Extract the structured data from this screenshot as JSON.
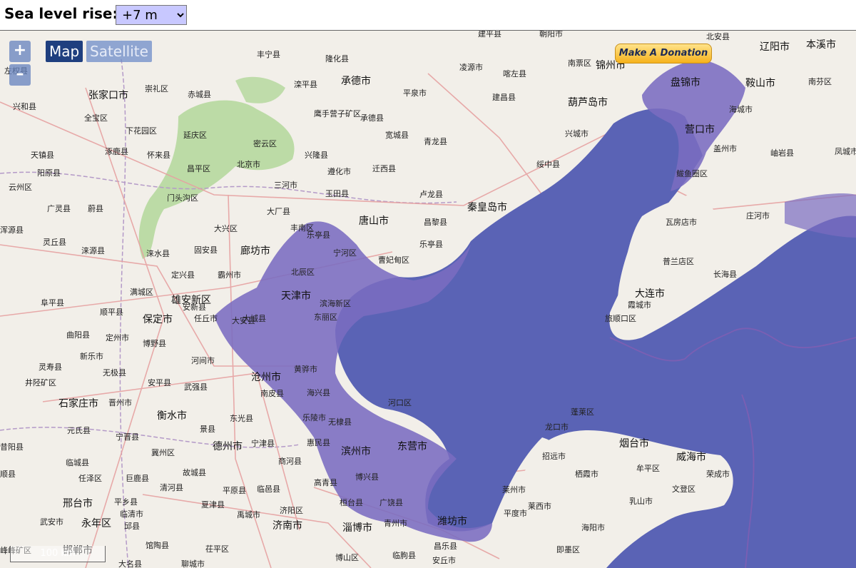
{
  "header": {
    "label": "Sea level rise:",
    "selected_value": "+7 m"
  },
  "controls": {
    "zoom_in": "+",
    "zoom_out": "–",
    "map_type_map": "Map",
    "map_type_satellite": "Satellite",
    "donate": "Make A Donation",
    "scale": "100 km"
  },
  "colors": {
    "water": "#5a63b5",
    "flood": "#7a6cc0",
    "land": "#f2efe9",
    "forest": "#a9d48f",
    "road": "#e8a0a0"
  },
  "places": [
    {
      "name": "建平县"
    },
    {
      "name": "朝阳市"
    },
    {
      "name": "北安县"
    },
    {
      "name": "辽阳市"
    },
    {
      "name": "本溪市"
    },
    {
      "name": "丰宁县"
    },
    {
      "name": "隆化县"
    },
    {
      "name": "凌源市"
    },
    {
      "name": "喀左县"
    },
    {
      "name": "南票区"
    },
    {
      "name": "锦州市"
    },
    {
      "name": "盘锦市"
    },
    {
      "name": "鞍山市"
    },
    {
      "name": "南芬区"
    },
    {
      "name": "张家口市"
    },
    {
      "name": "崇礼区"
    },
    {
      "name": "赤城县"
    },
    {
      "name": "滦平县"
    },
    {
      "name": "承德市"
    },
    {
      "name": "平泉市"
    },
    {
      "name": "建昌县"
    },
    {
      "name": "葫芦岛市"
    },
    {
      "name": "海城市"
    },
    {
      "name": "兴和县"
    },
    {
      "name": "全宝区"
    },
    {
      "name": "鹰手营子矿区"
    },
    {
      "name": "承德县"
    },
    {
      "name": "宽城县"
    },
    {
      "name": "青龙县"
    },
    {
      "name": "兴城市"
    },
    {
      "name": "营口市"
    },
    {
      "name": "下花园区"
    },
    {
      "name": "延庆区"
    },
    {
      "name": "密云区"
    },
    {
      "name": "兴隆县"
    },
    {
      "name": "盖州市"
    },
    {
      "name": "岫岩县"
    },
    {
      "name": "凤城市"
    },
    {
      "name": "天镇县"
    },
    {
      "name": "涿鹿县"
    },
    {
      "name": "怀来县"
    },
    {
      "name": "昌平区"
    },
    {
      "name": "北京市"
    },
    {
      "name": "遵化市"
    },
    {
      "name": "迁西县"
    },
    {
      "name": "绥中县"
    },
    {
      "name": "鲅鱼圈区"
    },
    {
      "name": "阳原县"
    },
    {
      "name": "三河市"
    },
    {
      "name": "玉田县"
    },
    {
      "name": "卢龙县"
    },
    {
      "name": "门头沟区"
    },
    {
      "name": "云州区"
    },
    {
      "name": "广灵县"
    },
    {
      "name": "蔚县"
    },
    {
      "name": "大厂县"
    },
    {
      "name": "唐山市"
    },
    {
      "name": "昌黎县"
    },
    {
      "name": "秦皇岛市"
    },
    {
      "name": "庄河市"
    },
    {
      "name": "瓦房店市"
    },
    {
      "name": "浑源县"
    },
    {
      "name": "大兴区"
    },
    {
      "name": "丰南区"
    },
    {
      "name": "乐亭县"
    },
    {
      "name": "灵丘县"
    },
    {
      "name": "涞源县"
    },
    {
      "name": "涞水县"
    },
    {
      "name": "固安县"
    },
    {
      "name": "廊坊市"
    },
    {
      "name": "宁河区"
    },
    {
      "name": "曹妃甸区"
    },
    {
      "name": "普兰店区"
    },
    {
      "name": "长海县"
    },
    {
      "name": "定兴县"
    },
    {
      "name": "霸州市"
    },
    {
      "name": "北辰区"
    },
    {
      "name": "满城区"
    },
    {
      "name": "雄安新区"
    },
    {
      "name": "天津市"
    },
    {
      "name": "滨海新区"
    },
    {
      "name": "大连市"
    },
    {
      "name": "阜平县"
    },
    {
      "name": "顺平县"
    },
    {
      "name": "保定市"
    },
    {
      "name": "任丘市"
    },
    {
      "name": "大城县"
    },
    {
      "name": "旅顺口区"
    },
    {
      "name": "曲阳县"
    },
    {
      "name": "定州市"
    },
    {
      "name": "博野县"
    },
    {
      "name": "新乐市"
    },
    {
      "name": "河间市"
    },
    {
      "name": "黄骅市"
    },
    {
      "name": "灵寿县"
    },
    {
      "name": "无极县"
    },
    {
      "name": "安平县"
    },
    {
      "name": "沧州市"
    },
    {
      "name": "井陉矿区"
    },
    {
      "name": "武强县"
    },
    {
      "name": "南皮县"
    },
    {
      "name": "海兴县"
    },
    {
      "name": "石家庄市"
    },
    {
      "name": "晋州市"
    },
    {
      "name": "河口区"
    },
    {
      "name": "衡水市"
    },
    {
      "name": "东光县"
    },
    {
      "name": "乐陵市"
    },
    {
      "name": "蓬莱区"
    },
    {
      "name": "元氏县"
    },
    {
      "name": "宁晋县"
    },
    {
      "name": "景县"
    },
    {
      "name": "无棣县"
    },
    {
      "name": "龙口市"
    },
    {
      "name": "昔阳县"
    },
    {
      "name": "冀州区"
    },
    {
      "name": "德州市"
    },
    {
      "name": "宁津县"
    },
    {
      "name": "惠民县"
    },
    {
      "name": "滨州市"
    },
    {
      "name": "东营市"
    },
    {
      "name": "烟台市"
    },
    {
      "name": "威海市"
    },
    {
      "name": "临城县"
    },
    {
      "name": "故城县"
    },
    {
      "name": "商河县"
    },
    {
      "name": "招远市"
    },
    {
      "name": "牟平区"
    },
    {
      "name": "顺县"
    },
    {
      "name": "任泽区"
    },
    {
      "name": "巨鹿县"
    },
    {
      "name": "博兴县"
    },
    {
      "name": "栖霞市"
    },
    {
      "name": "荣成市"
    },
    {
      "name": "清河县"
    },
    {
      "name": "高青县"
    },
    {
      "name": "邢台市"
    },
    {
      "name": "平乡县"
    },
    {
      "name": "平原县"
    },
    {
      "name": "临邑县"
    },
    {
      "name": "莱州市"
    },
    {
      "name": "文登区"
    },
    {
      "name": "夏津县"
    },
    {
      "name": "济阳区"
    },
    {
      "name": "桓台县"
    },
    {
      "name": "广饶县"
    },
    {
      "name": "莱西市"
    },
    {
      "name": "乳山市"
    },
    {
      "name": "临清市"
    },
    {
      "name": "禹城市"
    },
    {
      "name": "平度市"
    },
    {
      "name": "武安市"
    },
    {
      "name": "永年区"
    },
    {
      "name": "邱县"
    },
    {
      "name": "济南市"
    },
    {
      "name": "淄博市"
    },
    {
      "name": "青州市"
    },
    {
      "name": "潍坊市"
    },
    {
      "name": "海阳市"
    },
    {
      "name": "峰峰矿区"
    },
    {
      "name": "邯郸市"
    },
    {
      "name": "馆陶县"
    },
    {
      "name": "茌平区"
    },
    {
      "name": "博山区"
    },
    {
      "name": "昌乐县"
    },
    {
      "name": "即墨区"
    },
    {
      "name": "大名县"
    },
    {
      "name": "聊城市"
    },
    {
      "name": "临朐县"
    },
    {
      "name": "安丘市"
    },
    {
      "name": "左权县"
    },
    {
      "name": "东丽区"
    },
    {
      "name": "大安县"
    },
    {
      "name": "霞城市"
    },
    {
      "name": "安新县"
    },
    {
      "name": "乐亭县"
    }
  ]
}
